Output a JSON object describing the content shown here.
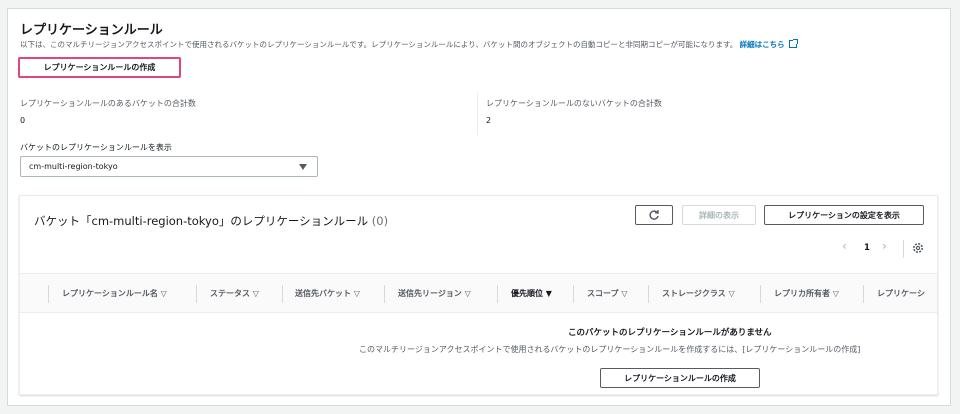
{
  "section": {
    "title": "レプリケーションルール",
    "description": "以下は、このマルチリージョンアクセスポイントで使用されるバケットのレプリケーションルールです。レプリケーションルールにより、バケット間のオブジェクトの自動コピーと非同期コピーが可能になります。",
    "learn_more": "詳細はこちら",
    "create_button": "レプリケーションルールの作成"
  },
  "stats": {
    "with_rules_label": "レプリケーションルールのあるバケットの合計数",
    "with_rules_value": "0",
    "without_rules_label": "レプリケーションルールのないバケットの合計数",
    "without_rules_value": "2"
  },
  "bucket_select": {
    "label": "バケットのレプリケーションルールを表示",
    "value": "cm-multi-region-tokyo"
  },
  "table": {
    "title": "バケット「cm-multi-region-tokyo」のレプリケーションルール",
    "count": "(0)",
    "refresh_icon": "refresh-icon",
    "details_button": "詳細の表示",
    "settings_button": "レプリケーションの設定を表示",
    "page": "1",
    "columns": [
      {
        "label": "レプリケーションルール名",
        "icon": "▽"
      },
      {
        "label": "ステータス",
        "icon": "▽"
      },
      {
        "label": "送信先バケット",
        "icon": "▽"
      },
      {
        "label": "送信先リージョン",
        "icon": "▽"
      },
      {
        "label": "優先順位",
        "icon": "▼"
      },
      {
        "label": "スコープ",
        "icon": "▽"
      },
      {
        "label": "ストレージクラス",
        "icon": "▽"
      },
      {
        "label": "レプリカ所有者",
        "icon": "▽"
      },
      {
        "label": "レプリケーシ",
        "icon": ""
      }
    ],
    "empty_title": "このバケットのレプリケーションルールがありません",
    "empty_description": "このマルチリージョンアクセスポイントで使用されるバケットのレプリケーションルールを作成するには、[レプリケーションルールの作成]",
    "empty_create_button": "レプリケーションルールの作成"
  },
  "colors": {
    "link": "#0073bb",
    "highlight_border": "#e0457b"
  }
}
